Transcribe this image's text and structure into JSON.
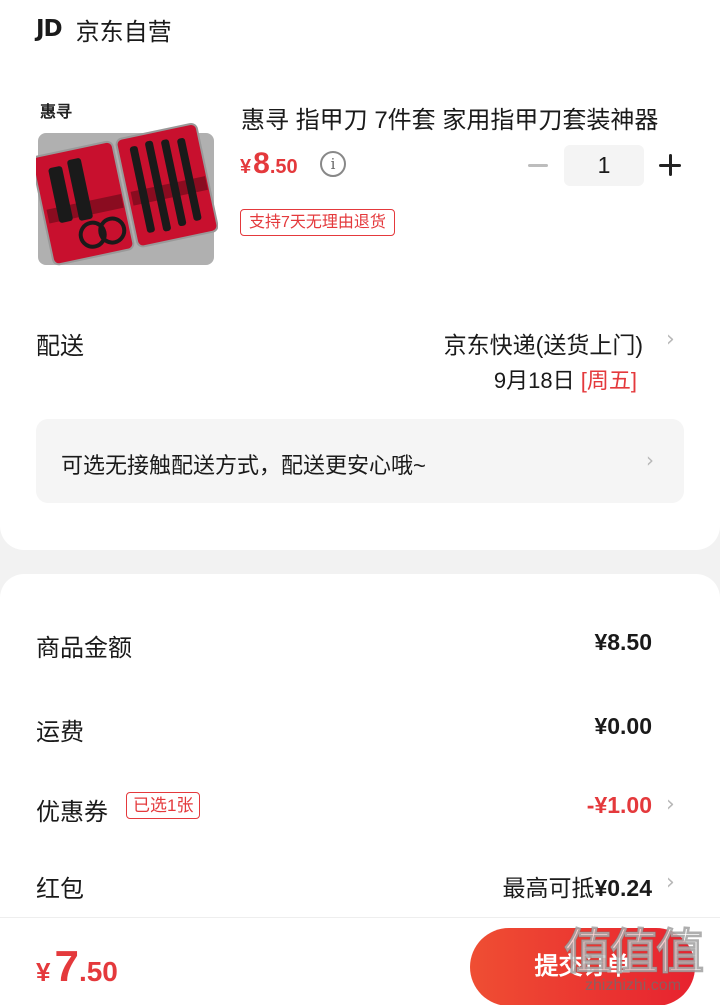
{
  "shop": {
    "logo": "JD",
    "name": "京东自营"
  },
  "product": {
    "title": "惠寻 指甲刀 7件套 家用指甲刀套装神器",
    "thumbnail_brand": "惠寻",
    "price": {
      "symbol": "¥",
      "integer": "8",
      "decimal": ".50"
    },
    "info_icon": "info-icon",
    "quantity": "1",
    "return_badge": "支持7天无理由退货"
  },
  "shipping": {
    "label": "配送",
    "method": "京东快递(送货上门)",
    "date": "9月18日",
    "weekday": "[周五]",
    "contactless": "可选无接触配送方式，配送更安心哦~"
  },
  "summary": {
    "goods_label": "商品金额",
    "goods_value": "¥8.50",
    "freight_label": "运费",
    "freight_value": "¥0.00",
    "coupon_label": "优惠券",
    "coupon_badge": "已选1张",
    "coupon_value": "-¥1.00",
    "hongbao_label": "红包",
    "hongbao_prefix": "最高可抵",
    "hongbao_value": "¥0.24"
  },
  "footer": {
    "total": {
      "symbol": "¥",
      "integer": "7",
      "decimal": ".50"
    },
    "submit": "提交订单"
  },
  "watermark": {
    "big": "值值值",
    "small": "zhizhizhi.com"
  },
  "colors": {
    "accent": "#e4393c",
    "button": "#e7222f"
  }
}
